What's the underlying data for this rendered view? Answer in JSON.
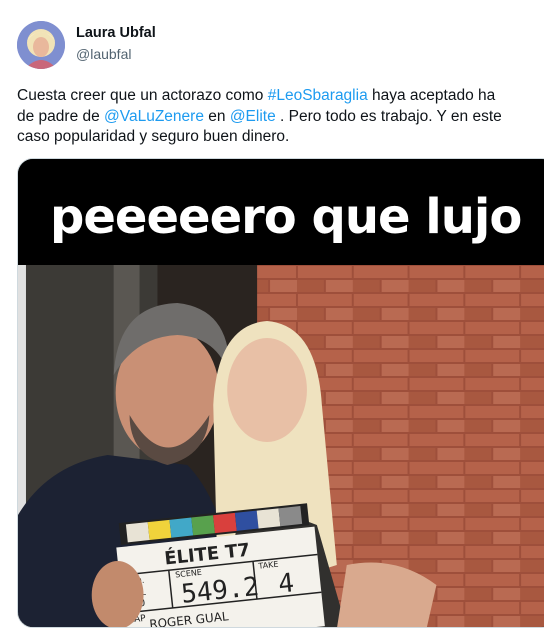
{
  "author": {
    "name": "Laura Ubfal",
    "handle": "@laubfal"
  },
  "tweet": {
    "line1_a": "Cuesta creer que un actorazo como ",
    "line1_tag": "#LeoSbaraglia",
    "line1_b": " haya aceptado ha",
    "line2_a": "de padre de ",
    "line2_mention1": "@VaLuZenere",
    "line2_b": " en ",
    "line2_mention2": "@Elite",
    "line2_c": " . Pero todo es trabajo. Y en este",
    "line3": "caso popularidad y seguro buen dinero."
  },
  "media": {
    "caption": "peeeeero que lujo",
    "slate": {
      "title": "ÉLITE T7",
      "scene_label": "SCENE",
      "take_label": "TAKE",
      "prod_label": "ROD.",
      "roll_label": "ROLL",
      "cap_label": "CAP",
      "roll_value": "300",
      "scene_value": "549.2",
      "take_value": "4",
      "director": "ROGER GUAL"
    }
  },
  "colors": {
    "link": "#1d9bf0",
    "handle": "#536471",
    "text": "#0f1419"
  }
}
